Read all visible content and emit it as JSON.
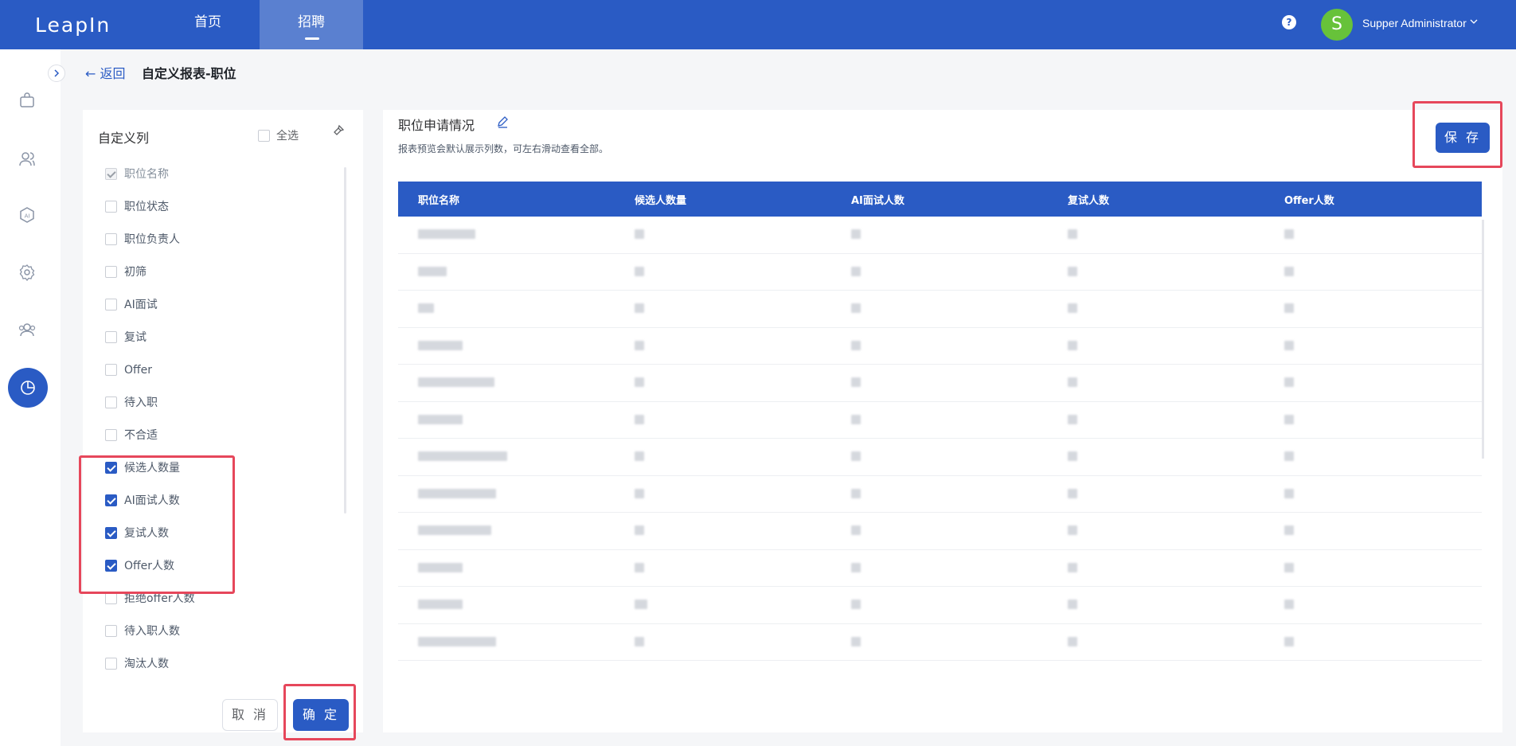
{
  "app": {
    "logo": "LeapIn"
  },
  "nav": {
    "home": "首页",
    "recruit": "招聘"
  },
  "user": {
    "help": "?",
    "avatar_letter": "S",
    "name": "Supper Administrator"
  },
  "header": {
    "back_label": "返回",
    "title": "自定义报表-职位"
  },
  "columns_panel": {
    "title": "自定义列",
    "select_all_label": "全选",
    "items": [
      {
        "label": "职位名称",
        "state": "disabled-checked"
      },
      {
        "label": "职位状态",
        "state": "unchecked"
      },
      {
        "label": "职位负责人",
        "state": "unchecked"
      },
      {
        "label": "初筛",
        "state": "unchecked"
      },
      {
        "label": "AI面试",
        "state": "unchecked"
      },
      {
        "label": "复试",
        "state": "unchecked"
      },
      {
        "label": "Offer",
        "state": "unchecked"
      },
      {
        "label": "待入职",
        "state": "unchecked"
      },
      {
        "label": "不合适",
        "state": "unchecked"
      },
      {
        "label": "候选人数量",
        "state": "checked"
      },
      {
        "label": "AI面试人数",
        "state": "checked"
      },
      {
        "label": "复试人数",
        "state": "checked"
      },
      {
        "label": "Offer人数",
        "state": "checked"
      },
      {
        "label": "拒绝offer人数",
        "state": "unchecked"
      },
      {
        "label": "待入职人数",
        "state": "unchecked"
      },
      {
        "label": "淘汰人数",
        "state": "unchecked"
      }
    ],
    "cancel_label": "取 消",
    "confirm_label": "确 定"
  },
  "report": {
    "title": "职位申请情况",
    "subtitle": "报表预览会默认展示列数，可左右滑动查看全部。",
    "save_label": "保 存",
    "headers": [
      "职位名称",
      "候选人数量",
      "AI面试人数",
      "复试人数",
      "Offer人数"
    ],
    "row_count": 12
  },
  "colors": {
    "primary": "#2a5bc4",
    "highlight": "#e6475b",
    "avatar": "#67c23a"
  }
}
